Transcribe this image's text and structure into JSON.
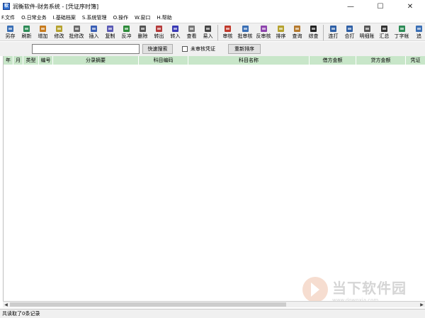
{
  "window": {
    "icon_glyph": "软",
    "title": "润衡软件-财务系统 - [凭证序时簿]",
    "controls": [
      "—",
      "☐",
      "✕"
    ]
  },
  "menu": [
    "F.文件",
    "O.日常业务",
    "I.基础档案",
    "S.系统管理",
    "O.操作",
    "W.窗口",
    "H.帮助"
  ],
  "toolbar": [
    {
      "label": "另存",
      "icon": "save-icon",
      "color": "#3a6fb5"
    },
    {
      "label": "刷新",
      "icon": "refresh-icon",
      "color": "#2e8b57"
    },
    {
      "label": "增加",
      "icon": "add-icon",
      "color": "#c77b1e"
    },
    {
      "label": "修改",
      "icon": "edit-icon",
      "color": "#b5a22e"
    },
    {
      "label": "批修改",
      "icon": "batch-edit-icon",
      "color": "#6a6a6a"
    },
    {
      "label": "插入",
      "icon": "insert-icon",
      "color": "#3a5fb5"
    },
    {
      "label": "复制",
      "icon": "copy-icon",
      "color": "#5a5ab5"
    },
    {
      "label": "反冲",
      "icon": "reverse-icon",
      "color": "#2e8b3a"
    },
    {
      "label": "删除",
      "icon": "delete-icon",
      "color": "#555555"
    },
    {
      "label": "转出",
      "icon": "export-icon",
      "color": "#b53a3a"
    },
    {
      "label": "转入",
      "icon": "import-icon",
      "color": "#3a3ab5"
    },
    {
      "label": "查看",
      "icon": "view-icon",
      "color": "#777777"
    },
    {
      "label": "易入",
      "icon": "easy-input-icon",
      "color": "#444444"
    },
    {
      "label": "审核",
      "icon": "audit-icon",
      "color": "#c0392b"
    },
    {
      "label": "批审核",
      "icon": "batch-audit-icon",
      "color": "#3a6fb5"
    },
    {
      "label": "反审核",
      "icon": "unaudit-icon",
      "color": "#8e44ad"
    },
    {
      "label": "排序",
      "icon": "sort-icon",
      "color": "#b5a22e"
    },
    {
      "label": "查询",
      "icon": "query-icon",
      "color": "#b57a2e"
    },
    {
      "label": "综查",
      "icon": "binoculars-icon",
      "color": "#222222"
    },
    {
      "label": "连打",
      "icon": "print-continuous-icon",
      "color": "#2e5fa5"
    },
    {
      "label": "合打",
      "icon": "print-merge-icon",
      "color": "#2e5fa5"
    },
    {
      "label": "明细账",
      "icon": "ledger-icon",
      "color": "#555555"
    },
    {
      "label": "汇总",
      "icon": "sum-icon",
      "color": "#333333"
    },
    {
      "label": "丁字帐",
      "icon": "t-account-icon",
      "color": "#2e8b57"
    },
    {
      "label": "追",
      "icon": "trace-icon",
      "color": "#3a6fb5"
    }
  ],
  "search": {
    "value": "",
    "quick_search_label": "快速搜索",
    "unaudited_label": "未审核凭证",
    "reorder_label": "重新排序"
  },
  "grid": {
    "columns": [
      "年",
      "月",
      "类型",
      "编号",
      "分录摘要",
      "科目编码",
      "科目名称",
      "借方金额",
      "贷方金额",
      "凭证"
    ],
    "rows": []
  },
  "scroll": {
    "left_arrow": "◀",
    "right_arrow": "▶"
  },
  "status": {
    "text": "共读取了0条记录"
  },
  "watermark": {
    "text": "当下软件园",
    "url": "www.downxia.com"
  }
}
